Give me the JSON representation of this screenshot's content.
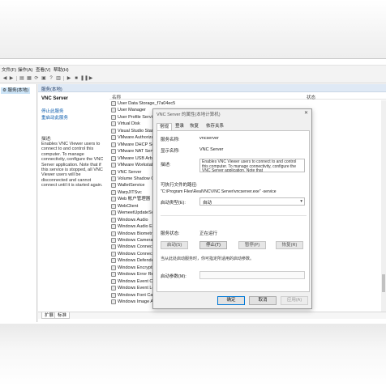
{
  "menu": {
    "items": [
      "文件(F)",
      "操作(A)",
      "查看(V)",
      "帮助(H)"
    ]
  },
  "tree": {
    "selected": "服务(本地)"
  },
  "pane": {
    "title": "服务(本地)"
  },
  "description": {
    "service_name": "VNC Server",
    "stop_link": "停止此服务",
    "restart_link": "重启动此服务",
    "desc_label": "描述:",
    "desc_text": "Enables VNC Viewer users to connect to and control this computer. To manage connectivity, configure the VNC Server application. Note that if this service is stopped, all VNC Viewer users will be disconnected and cannot connect until it is started again."
  },
  "columns": {
    "name": "名称",
    "status": "状态"
  },
  "services": [
    "User Data Storage_f7a04ec5",
    "User Manager",
    "User Profile Service",
    "Virtual Disk",
    "Visual Studio Stan",
    "VMware Authorizati",
    "VMware DHCP Serv",
    "VMware NAT Servic",
    "VMware USB Arbitr",
    "VMware Workstatio",
    "VNC Server",
    "Volume Shadow Co",
    "WalletService",
    "WarpJITSvc",
    "Web 帐户管理器",
    "WebClient",
    "WemeetUpdateSvc",
    "Windows Audio",
    "Windows Audio En",
    "Windows Biometri",
    "Windows Camera",
    "Windows Connect",
    "Windows Connect",
    "Windows Defende",
    "Windows Encrypti",
    "Windows Error Re",
    "Windows Event Co",
    "Windows Event Lo",
    "Windows Font Cac",
    "Windows Image Acquisition (WIA)"
  ],
  "bottom_tabs": {
    "extended": "扩展",
    "standard": "标准"
  },
  "dialog": {
    "title": "VNC Server 的属性(本地计算机)",
    "close": "✕",
    "tabs": [
      "常规",
      "登录",
      "恢复",
      "依存关系"
    ],
    "service_name_label": "服务名称:",
    "service_name": "vncserver",
    "display_name_label": "显示名称:",
    "display_name": "VNC Server",
    "description_label": "描述:",
    "description": "Enables VNC Viewer users to connect to and control this computer. To manage connectivity, configure the VNC Server application. Note that",
    "path_label": "可执行文件的路径:",
    "path": "\"C:\\Program Files\\RealVNC\\VNC Server\\vncserver.exe\" -service",
    "startup_label": "启动类型(E):",
    "startup_value": "自动",
    "status_label": "服务状态:",
    "status_value": "正在运行",
    "buttons": {
      "start": "启动(S)",
      "stop": "停止(T)",
      "pause": "暂停(P)",
      "resume": "恢复(R)"
    },
    "hint": "当从此处启动服务时，你可指定所适用的启动参数。",
    "param_label": "启动参数(M):",
    "ok": "确定",
    "cancel": "取消",
    "apply": "应用(A)"
  }
}
